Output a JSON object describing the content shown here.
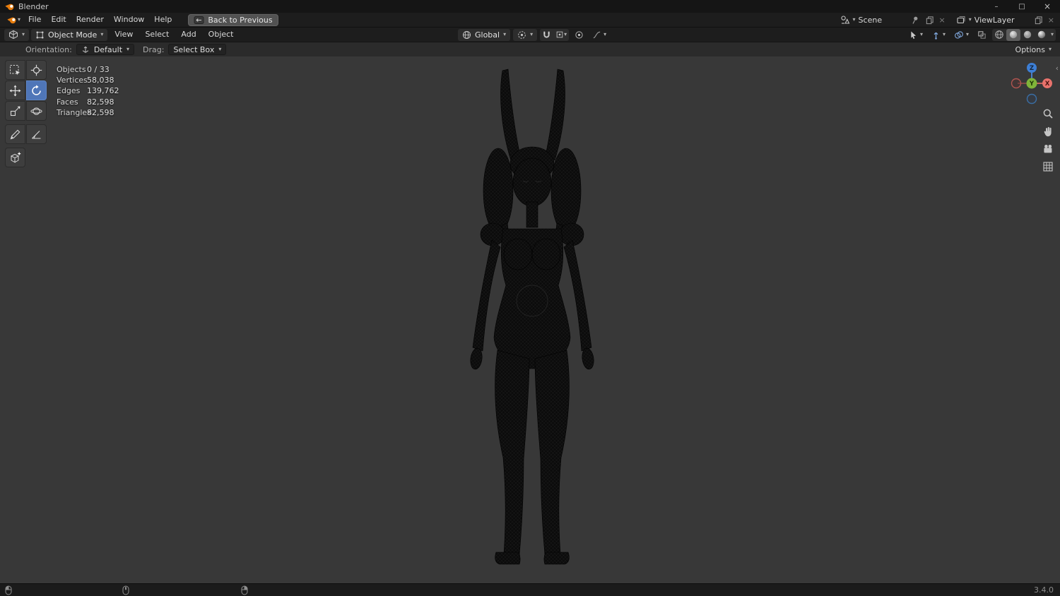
{
  "window": {
    "title": "Blender",
    "version": "3.4.0"
  },
  "icons": {
    "caret": "▾",
    "minimize": "–",
    "maximize": "□",
    "close": "×",
    "back_arrow": "←",
    "sidebar_toggle": "‹",
    "unlink": "×"
  },
  "topbar": {
    "menus": [
      "File",
      "Edit",
      "Render",
      "Window",
      "Help"
    ],
    "back_button": "Back to Previous",
    "scene": "Scene",
    "view_layer": "ViewLayer"
  },
  "header": {
    "mode": "Object Mode",
    "menus": [
      "View",
      "Select",
      "Add",
      "Object"
    ],
    "orientation": "Global"
  },
  "tool_settings": {
    "orientation_label": "Orientation:",
    "orientation_value": "Default",
    "drag_label": "Drag:",
    "drag_value": "Select Box",
    "options": "Options"
  },
  "viewport": {
    "stats": [
      {
        "label": "Objects",
        "value": "0 / 33"
      },
      {
        "label": "Vertices",
        "value": "58,038"
      },
      {
        "label": "Edges",
        "value": "139,762"
      },
      {
        "label": "Faces",
        "value": "82,598"
      },
      {
        "label": "Triangles",
        "value": "82,598"
      }
    ],
    "gizmo": {
      "x": "X",
      "y": "Y",
      "z": "Z"
    }
  },
  "colors": {
    "accent_blue": "#4f76b8",
    "viewport_bg": "#383838",
    "axis_x": "#e8726c",
    "axis_y": "#7fb439",
    "axis_z": "#3d7fd6",
    "logo_orange": "#e87d0d"
  }
}
